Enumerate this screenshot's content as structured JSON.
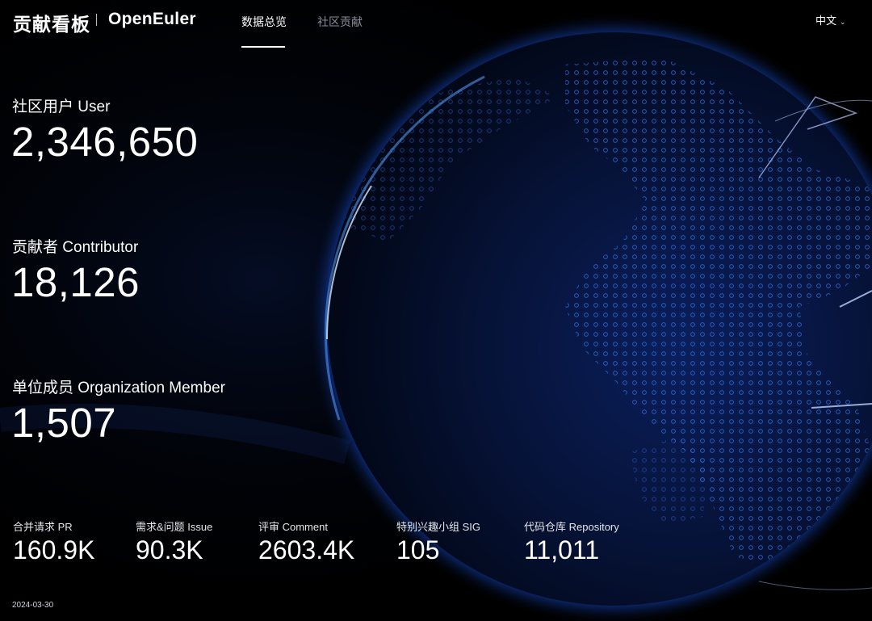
{
  "header": {
    "title": "贡献看板",
    "logo_text": "OpenEuler",
    "tabs": [
      {
        "label": "数据总览",
        "active": true
      },
      {
        "label": "社区贡献",
        "active": false
      }
    ],
    "language": "中文"
  },
  "stats": [
    {
      "label": "社区用户 User",
      "value": "2,346,650"
    },
    {
      "label": "贡献者 Contributor",
      "value": "18,126"
    },
    {
      "label": "单位成员 Organization Member",
      "value": "1,507"
    }
  ],
  "metrics": [
    {
      "label": "合并请求 PR",
      "value": "160.9K"
    },
    {
      "label": "需求&问题 Issue",
      "value": "90.3K"
    },
    {
      "label": "评审 Comment",
      "value": "2603.4K"
    },
    {
      "label": "特别兴趣小组 SIG",
      "value": "105"
    },
    {
      "label": "代码仓库 Repository",
      "value": "11,011"
    }
  ],
  "date": "2024-03-30",
  "colors": {
    "background": "#000000",
    "globe_glow": "#1e6fff",
    "inactive_tab": "#8a8f9a"
  }
}
